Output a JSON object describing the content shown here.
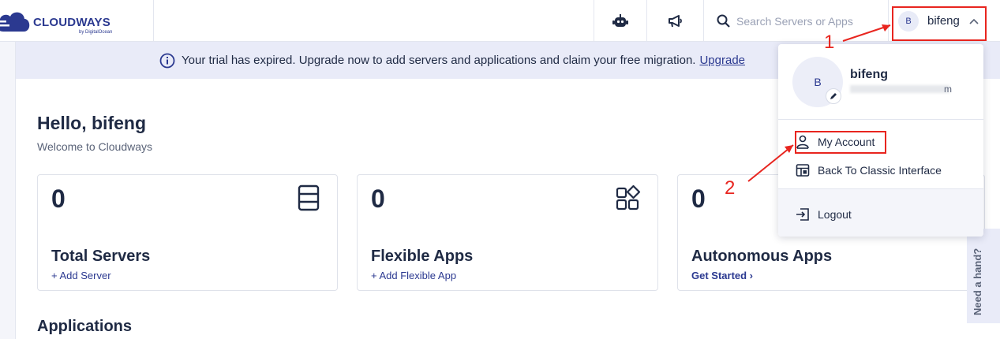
{
  "brand": {
    "name": "CLOUDWAYS",
    "sub": "by DigitalOcean",
    "color": "#2b3990"
  },
  "header": {
    "search_placeholder": "Search Servers or Apps",
    "user_initial": "B",
    "user_name": "bifeng"
  },
  "banner": {
    "text": "Your trial has expired. Upgrade now to add servers and applications and claim your free migration.",
    "link": "Upgrade"
  },
  "main": {
    "greeting": "Hello, bifeng",
    "subtitle": "Welcome to Cloudways",
    "cards": [
      {
        "count": "0",
        "title": "Total Servers",
        "link": "+ Add Server",
        "icon": "server-icon"
      },
      {
        "count": "0",
        "title": "Flexible Apps",
        "link": "+ Add Flexible App",
        "icon": "apps-grid-icon"
      },
      {
        "count": "0",
        "title": "Autonomous Apps",
        "link": "Get Started ›",
        "icon": ""
      }
    ],
    "applications_heading": "Applications"
  },
  "help_tab": {
    "label": "Need a hand?"
  },
  "dropdown": {
    "avatar_initial": "B",
    "name": "bifeng",
    "email_tail": "m",
    "items": [
      {
        "label": "My Account",
        "icon": "user-icon"
      },
      {
        "label": "Back To Classic Interface",
        "icon": "classic-layout-icon"
      },
      {
        "label": "Logout",
        "icon": "logout-icon"
      }
    ]
  },
  "annotations": {
    "step1": "1",
    "step2": "2",
    "color": "#e8251f"
  }
}
